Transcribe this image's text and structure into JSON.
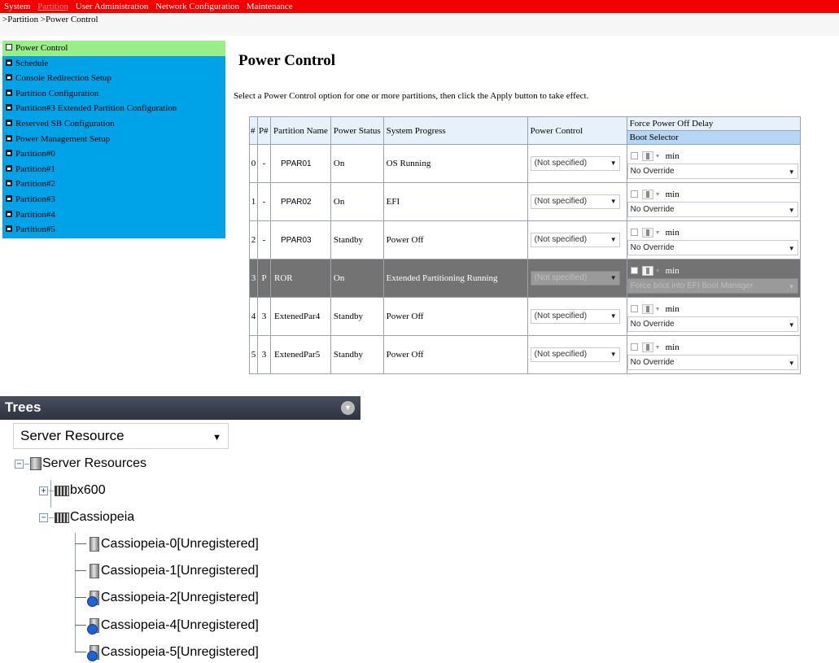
{
  "topbar": {
    "menu": [
      {
        "label": "System",
        "active": false
      },
      {
        "label": "Partition",
        "active": true
      },
      {
        "label": "User Administration",
        "active": false
      },
      {
        "label": "Network Configuration",
        "active": false
      },
      {
        "label": "Maintenance",
        "active": false
      }
    ]
  },
  "breadcrumb": ">Partition >Power Control",
  "sidebar": {
    "items": [
      {
        "label": "Power Control"
      },
      {
        "label": "Schedule"
      },
      {
        "label": "Console Redirection Setup"
      },
      {
        "label": "Partition Configuration"
      },
      {
        "label": "Partition#3 Extended Partition Configuration"
      },
      {
        "label": "Reserved SB Configuration"
      },
      {
        "label": "Power Management Setup"
      },
      {
        "label": "Partition#0"
      },
      {
        "label": "Partition#1"
      },
      {
        "label": "Partition#2"
      },
      {
        "label": "Partition#3"
      },
      {
        "label": "Partition#4"
      },
      {
        "label": "Partition#5"
      }
    ]
  },
  "main": {
    "title": "Power Control",
    "instructions": "Select a Power Control option for one or more partitions, then click the Apply button to take effect."
  },
  "table": {
    "headers": {
      "num": "#",
      "pnum": "P#",
      "name": "Partition Name",
      "status": "Power Status",
      "progress": "System Progress",
      "control": "Power Control",
      "delay": "Force Power Off Delay",
      "boot": "Boot Selector"
    },
    "min_label": "min",
    "rows": [
      {
        "num": "0",
        "pnum": "-",
        "name": "PPAR01",
        "status": "On",
        "progress": "OS Running",
        "control": "(Not specified)",
        "boot": "No Override"
      },
      {
        "num": "1",
        "pnum": "-",
        "name": "PPAR02",
        "status": "On",
        "progress": "EFI",
        "control": "(Not specified)",
        "boot": "No Override"
      },
      {
        "num": "2",
        "pnum": "-",
        "name": "PPAR03",
        "status": "Standby",
        "progress": "Power Off",
        "control": "(Not specified)",
        "boot": "No Override"
      },
      {
        "num": "3",
        "pnum": "P",
        "name": "ROR",
        "status": "On",
        "progress": "Extended Partitioning Running",
        "control": "(Not specified)",
        "boot": "Force boot into EFI Boot Manager"
      },
      {
        "num": "4",
        "pnum": "3",
        "name": "ExtenedPar4",
        "status": "Standby",
        "progress": "Power Off",
        "control": "(Not specified)",
        "boot": "No Override"
      },
      {
        "num": "5",
        "pnum": "3",
        "name": "ExtenedPar5",
        "status": "Standby",
        "progress": "Power Off",
        "control": "(Not specified)",
        "boot": "No Override"
      }
    ]
  },
  "trees": {
    "title": "Trees",
    "selector": "Server Resource",
    "root": "Server Resources",
    "nodes": {
      "bx600": "bx600",
      "cassiopeia": "Cassiopeia",
      "c0": "Cassiopeia-0[Unregistered]",
      "c1": "Cassiopeia-1[Unregistered]",
      "c2": "Cassiopeia-2[Unregistered]",
      "c4": "Cassiopeia-4[Unregistered]",
      "c5": "Cassiopeia-5[Unregistered]"
    }
  },
  "colors": {
    "topbar": "#f20000",
    "sidebar": "#00a2e8",
    "sidebar_active": "#99ee88",
    "selected_row": "#737373"
  }
}
